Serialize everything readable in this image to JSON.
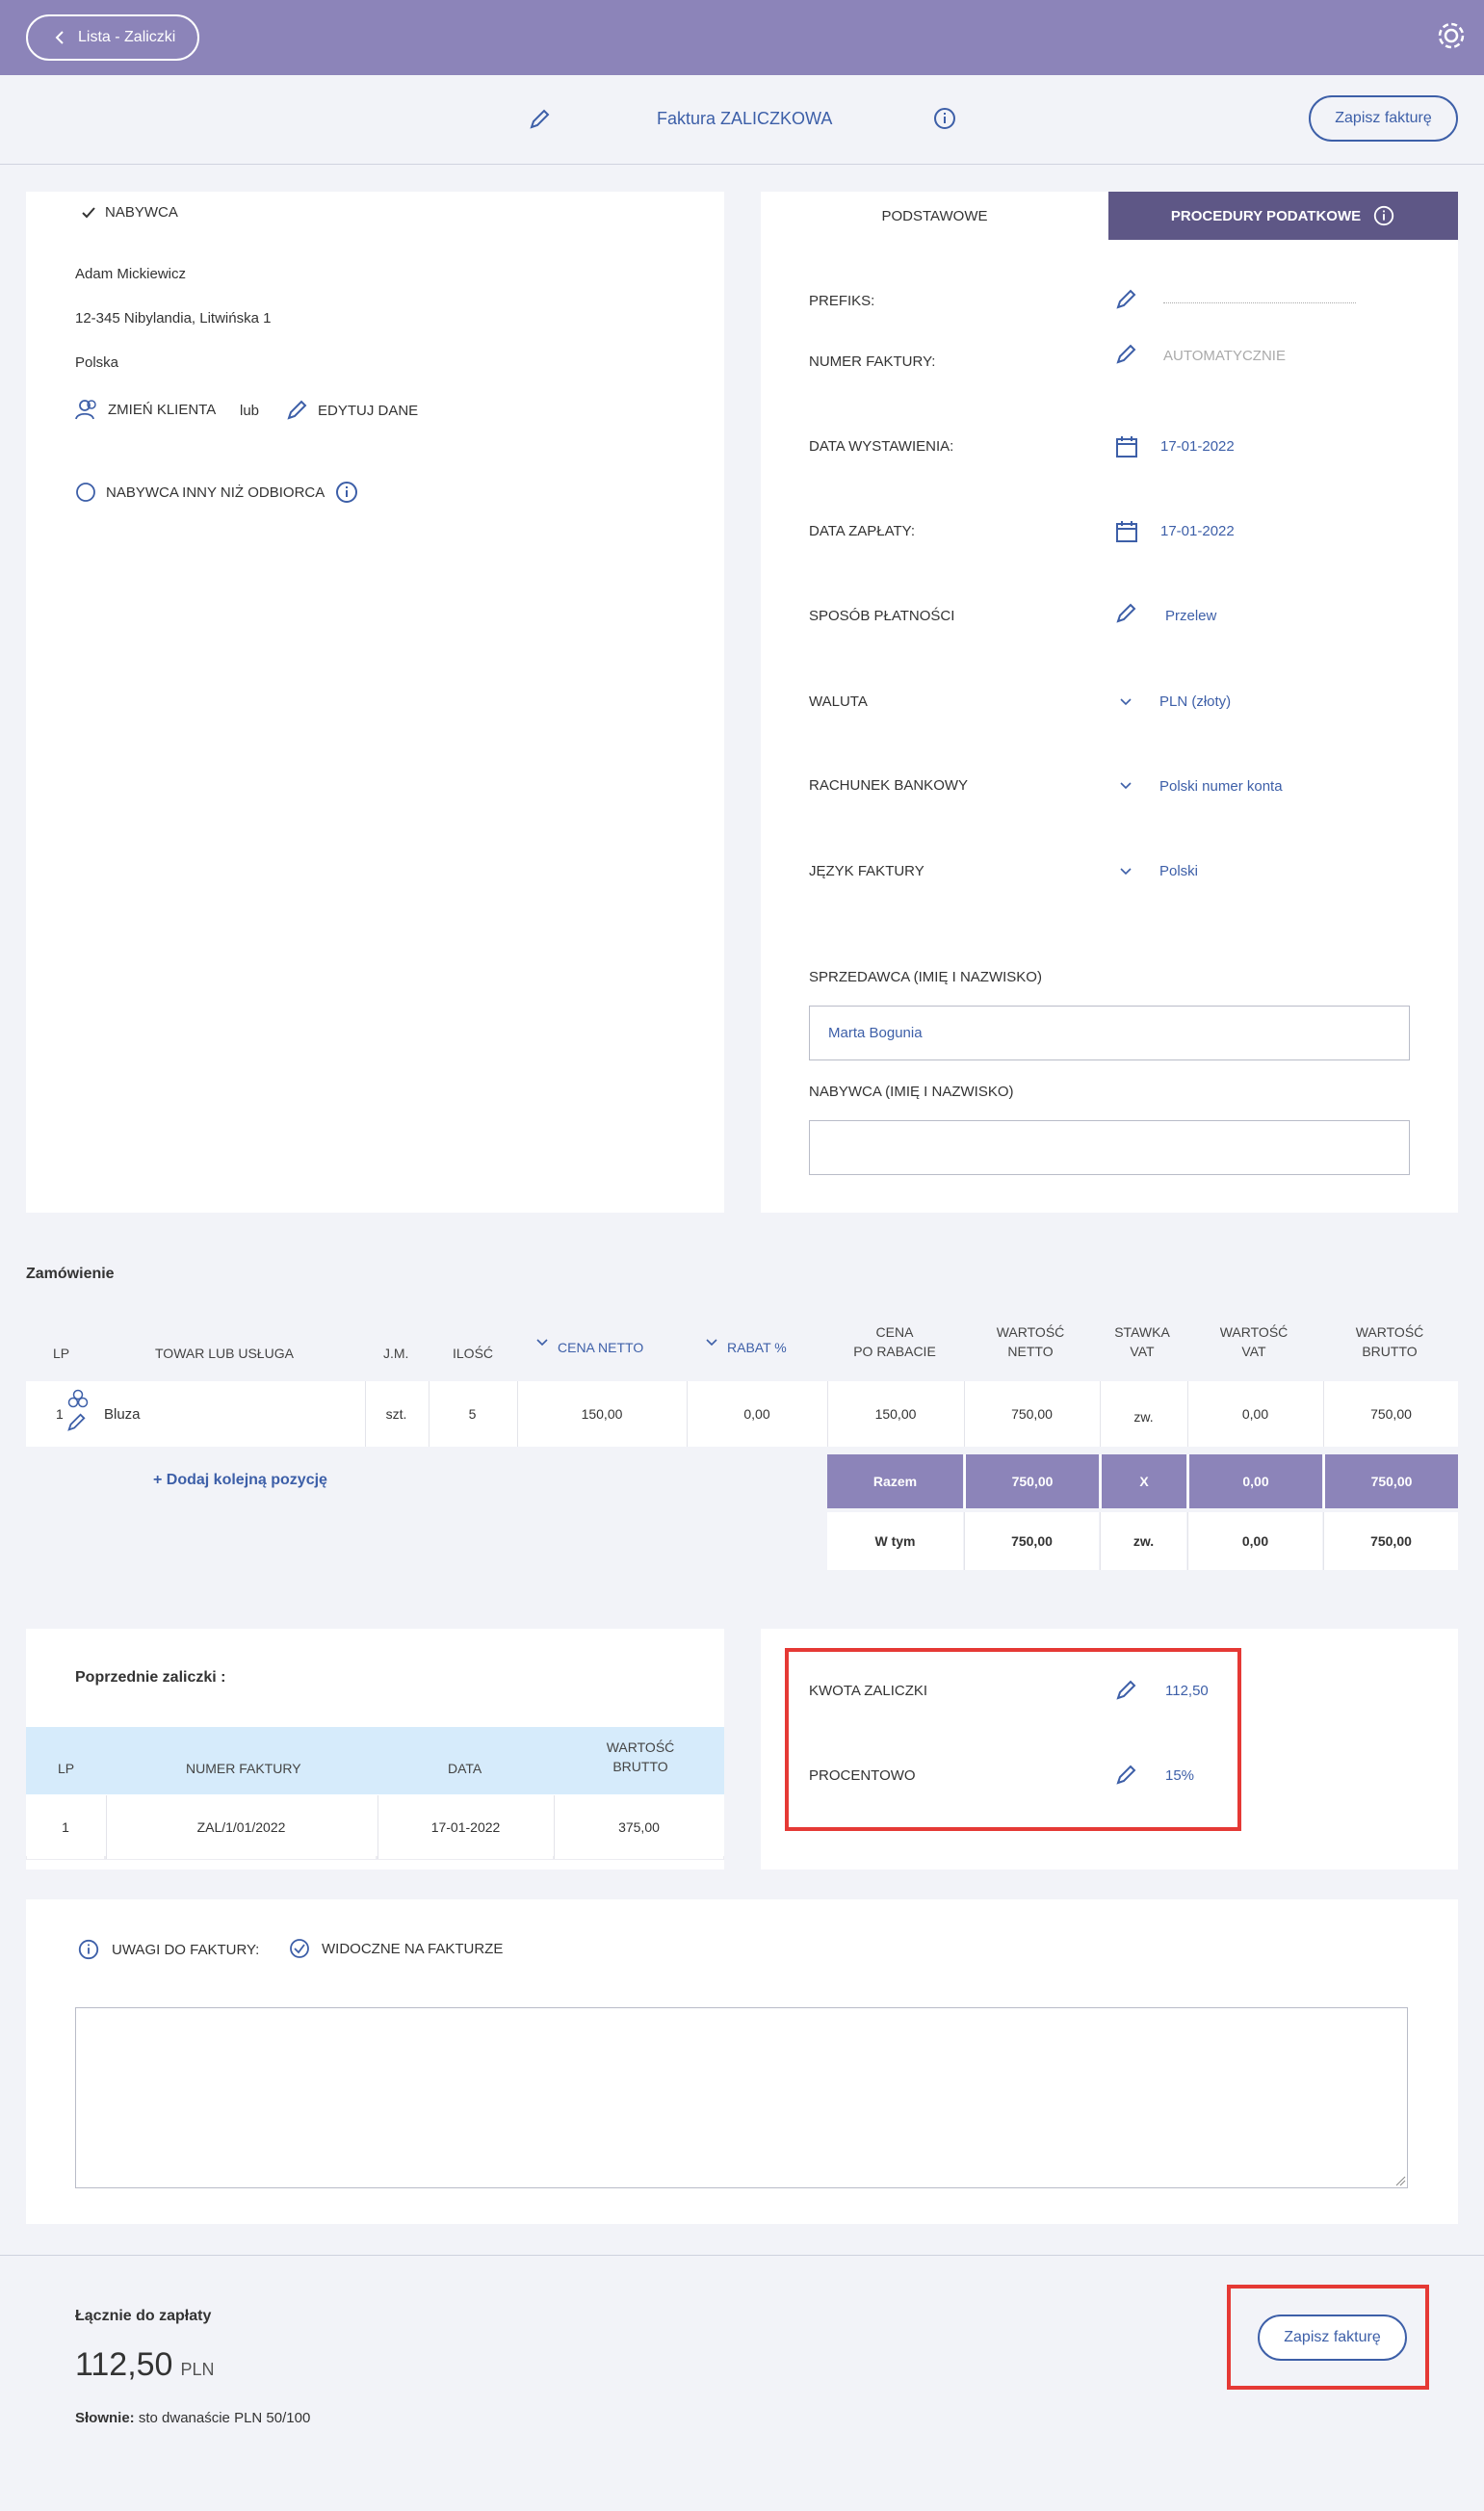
{
  "topbar": {
    "back_label": "Lista - Zaliczki"
  },
  "header": {
    "title": "Faktura ZALICZKOWA",
    "save_label": "Zapisz fakturę"
  },
  "buyer": {
    "section_label": "NABYWCA",
    "name": "Adam Mickiewicz",
    "address": "12-345 Nibylandia, Litwińska 1",
    "country": "Polska",
    "change_client": "ZMIEŃ KLIENTA",
    "or": "lub",
    "edit_data": "EDYTUJ DANE",
    "other_recipient": "NABYWCA INNY NIŻ ODBIORCA"
  },
  "tabs": {
    "basic": "PODSTAWOWE",
    "tax": "PROCEDURY PODATKOWE"
  },
  "fields": {
    "prefix_label": "PREFIKS:",
    "prefix_value": "",
    "number_label": "NUMER FAKTURY:",
    "number_value": "AUTOMATYCZNIE",
    "issue_date_label": "DATA WYSTAWIENIA:",
    "issue_date_value": "17-01-2022",
    "payment_date_label": "DATA ZAPŁATY:",
    "payment_date_value": "17-01-2022",
    "payment_method_label": "SPOSÓB PŁATNOŚCI",
    "payment_method_value": "Przelew",
    "currency_label": "WALUTA",
    "currency_value": "PLN (złoty)",
    "bank_label": "RACHUNEK BANKOWY",
    "bank_value": "Polski numer konta",
    "language_label": "JĘZYK FAKTURY",
    "language_value": "Polski",
    "seller_label": "SPRZEDAWCA (IMIĘ I NAZWISKO)",
    "seller_value": "Marta Bogunia",
    "buyer_name_label": "NABYWCA (IMIĘ I NAZWISKO)",
    "buyer_name_value": ""
  },
  "order": {
    "title": "Zamówienie",
    "headers": {
      "lp": "LP",
      "item": "TOWAR LUB USŁUGA",
      "unit": "J.M.",
      "qty": "ILOŚĆ",
      "net_price": "CENA NETTO",
      "discount": "RABAT %",
      "price_after_1": "CENA",
      "price_after_2": "PO RABACIE",
      "net_value_1": "WARTOŚĆ",
      "net_value_2": "NETTO",
      "vat_rate_1": "STAWKA",
      "vat_rate_2": "VAT",
      "vat_value_1": "WARTOŚĆ",
      "vat_value_2": "VAT",
      "gross_value_1": "WARTOŚĆ",
      "gross_value_2": "BRUTTO"
    },
    "row": {
      "lp": "1",
      "item": "Bluza",
      "unit": "szt.",
      "qty": "5",
      "net_price": "150,00",
      "discount": "0,00",
      "price_after": "150,00",
      "net_value": "750,00",
      "vat_rate": "zw.",
      "vat_value": "0,00",
      "gross_value": "750,00"
    },
    "add_item": "+ Dodaj kolejną pozycję",
    "total": {
      "label": "Razem",
      "net": "750,00",
      "vat_rate": "X",
      "vat": "0,00",
      "gross": "750,00"
    },
    "including": {
      "label": "W tym",
      "net": "750,00",
      "vat_rate": "zw.",
      "vat": "0,00",
      "gross": "750,00"
    }
  },
  "previous": {
    "title": "Poprzednie zaliczki :",
    "headers": {
      "lp": "LP",
      "number": "NUMER FAKTURY",
      "date": "DATA",
      "gross_1": "WARTOŚĆ",
      "gross_2": "BRUTTO"
    },
    "row": {
      "lp": "1",
      "number": "ZAL/1/01/2022",
      "date": "17-01-2022",
      "gross": "375,00"
    }
  },
  "advance": {
    "amount_label": "KWOTA ZALICZKI",
    "amount_value": "112,50",
    "percent_label": "PROCENTOWO",
    "percent_value": "15%"
  },
  "notes": {
    "label": "UWAGI DO FAKTURY:",
    "visible_label": "WIDOCZNE NA FAKTURZE",
    "text": ""
  },
  "footer": {
    "total_label": "Łącznie do zapłaty",
    "amount": "112,50",
    "currency": "PLN",
    "words_label": "Słownie:",
    "words_value": "sto dwanaście PLN 50/100",
    "save_label": "Zapisz fakturę"
  },
  "colors": {
    "accent": "#8c84b9",
    "dark_accent": "#5e5786",
    "link": "#3d5fa8",
    "highlight": "#e53935",
    "table_header": "#d6ebfb"
  }
}
